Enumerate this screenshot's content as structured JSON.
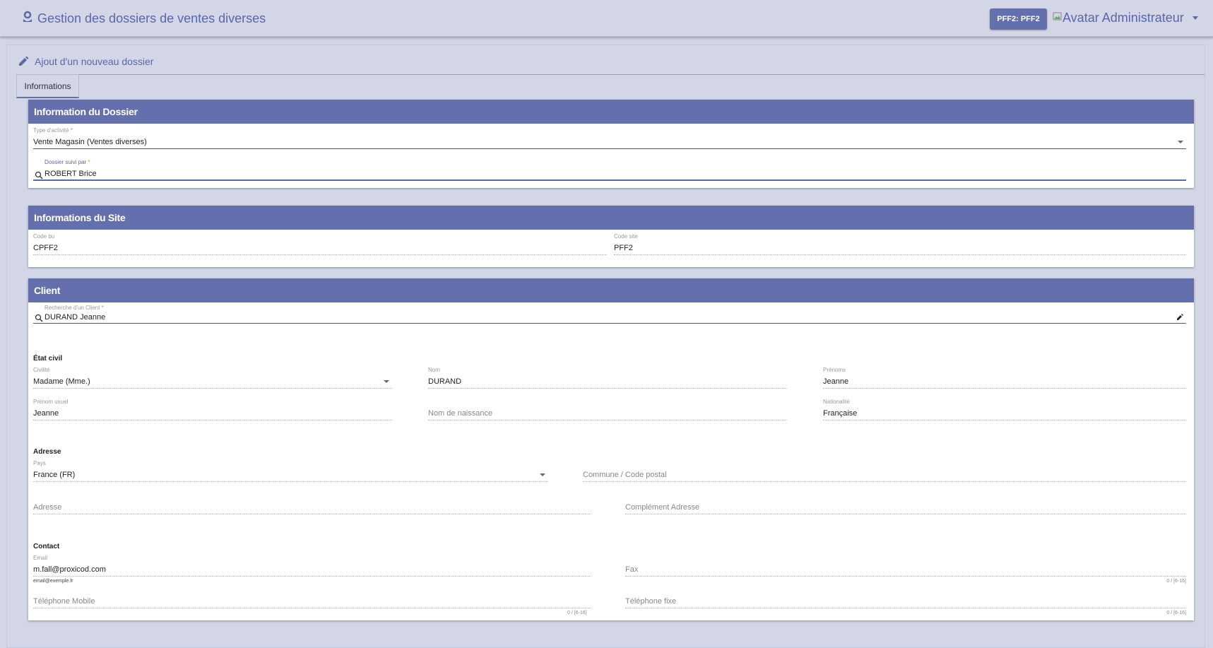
{
  "header": {
    "app_title": "Gestion des dossiers de ventes diverses",
    "site_button": "PFF2: PFF2",
    "user_name": "Avatar Administrateur"
  },
  "page": {
    "title": "Ajout d'un nouveau dossier",
    "tabs": [
      {
        "label": "Informations"
      }
    ]
  },
  "dossier": {
    "title": "Information du Dossier",
    "type_activite": {
      "label": "Type d'activité *",
      "label_text": "Type d'activité",
      "value": "Vente Magasin (Ventes diverses)"
    },
    "suivi_par": {
      "label_text": "Dossier suivi par ",
      "required_mark": "*",
      "value": "ROBERT Brice"
    }
  },
  "site": {
    "title": "Informations du Site",
    "code_bu": {
      "label": "Code bu",
      "value": "CPFF2"
    },
    "code_site": {
      "label": "Code site",
      "value": "PFF2"
    }
  },
  "client": {
    "title": "Client",
    "recherche": {
      "label": "Recherche d'un Client *",
      "value": "DURAND Jeanne"
    },
    "etat_civil": {
      "title": "État civil",
      "civilite": {
        "label": "Civilité",
        "value": "Madame (Mme.)"
      },
      "nom": {
        "label": "Nom",
        "value": "DURAND"
      },
      "prenoms": {
        "label": "Prénoms",
        "value": "Jeanne"
      },
      "prenom_usuel": {
        "label": "Prénom usuel",
        "value": "Jeanne"
      },
      "nom_naissance": {
        "placeholder": "Nom de naissance"
      },
      "nationalite": {
        "label": "Nationalité",
        "value": "Française"
      }
    },
    "adresse": {
      "title": "Adresse",
      "pays": {
        "label": "Pays",
        "value": "France (FR)"
      },
      "commune": {
        "placeholder": "Commune / Code postal"
      },
      "adresse": {
        "placeholder": "Adresse"
      },
      "complement": {
        "placeholder": "Complément Adresse"
      }
    },
    "contact": {
      "title": "Contact",
      "email": {
        "label": "Email",
        "value": "m.fall@proxicod.com",
        "hint": "email@exemple.fr"
      },
      "fax": {
        "placeholder": "Fax",
        "counter": "0 / [6-16]"
      },
      "tel_mobile": {
        "placeholder": "Téléphone Mobile",
        "counter": "0 / [6-16]"
      },
      "tel_fixe": {
        "placeholder": "Téléphone fixe",
        "counter": "0 / [6-16]"
      }
    }
  },
  "colors": {
    "primary": "#6470ad",
    "background": "#d2d6e6",
    "accent_required": "#e5a10b"
  }
}
